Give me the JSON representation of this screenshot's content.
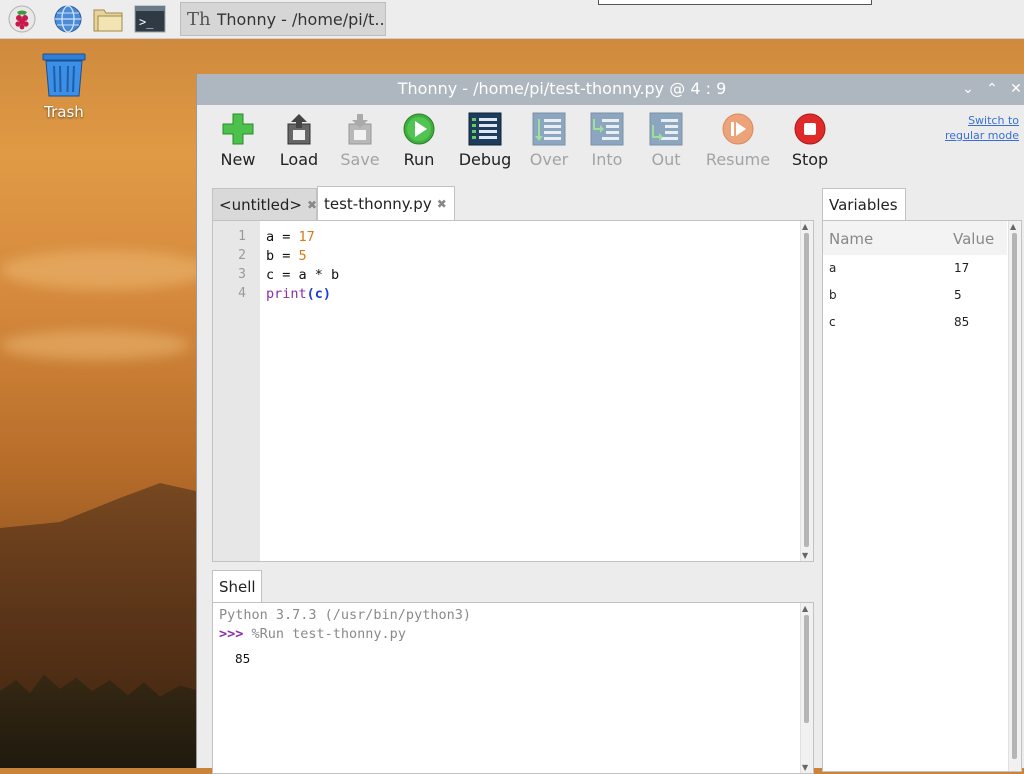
{
  "taskbar": {
    "task_label": "Thonny  -  /home/pi/t...",
    "task_icon": "Th"
  },
  "desktop": {
    "trash_label": "Trash"
  },
  "window": {
    "title": "Thonny  -  /home/pi/test-thonny.py  @  4 : 9",
    "minimize": "⌄",
    "maximize": "⌃",
    "close": "✕"
  },
  "toolbar": {
    "buttons": [
      {
        "label": "New",
        "enabled": true
      },
      {
        "label": "Load",
        "enabled": true
      },
      {
        "label": "Save",
        "enabled": false
      },
      {
        "label": "Run",
        "enabled": true
      },
      {
        "label": "Debug",
        "enabled": true
      },
      {
        "label": "Over",
        "enabled": false
      },
      {
        "label": "Into",
        "enabled": false
      },
      {
        "label": "Out",
        "enabled": false
      },
      {
        "label": "Resume",
        "enabled": false
      },
      {
        "label": "Stop",
        "enabled": true
      }
    ],
    "switch_line1": "Switch to",
    "switch_line2": "regular mode"
  },
  "editor": {
    "tabs": [
      {
        "label": "<untitled>",
        "close": "✖"
      },
      {
        "label": "test-thonny.py",
        "close": "✖"
      }
    ],
    "lines": [
      {
        "no": "1"
      },
      {
        "no": "2"
      },
      {
        "no": "3"
      },
      {
        "no": "4"
      }
    ],
    "code": {
      "l1_var": "a = ",
      "l1_num": "17",
      "l2_var": "b = ",
      "l2_num": "5",
      "l3": "c = a * b",
      "l4_fn": "print",
      "l4_open": "(",
      "l4_arg": "c",
      "l4_close": ")"
    }
  },
  "shell": {
    "tab_label": "Shell",
    "banner": "Python 3.7.3 (/usr/bin/python3)",
    "prompt": ">>> ",
    "command": "%Run test-thonny.py",
    "output": "85"
  },
  "variables": {
    "tab_label": "Variables",
    "col_name": "Name",
    "col_value": "Value",
    "rows": [
      {
        "name": "a",
        "value": "17"
      },
      {
        "name": "b",
        "value": "5"
      },
      {
        "name": "c",
        "value": "85"
      }
    ]
  },
  "colors": {
    "titlebar": "#aeb7bf",
    "run_green": "#3fae3f",
    "stop_red": "#e02a2a",
    "number_orange": "#d97814",
    "keyword_purple": "#8a2fa8"
  }
}
